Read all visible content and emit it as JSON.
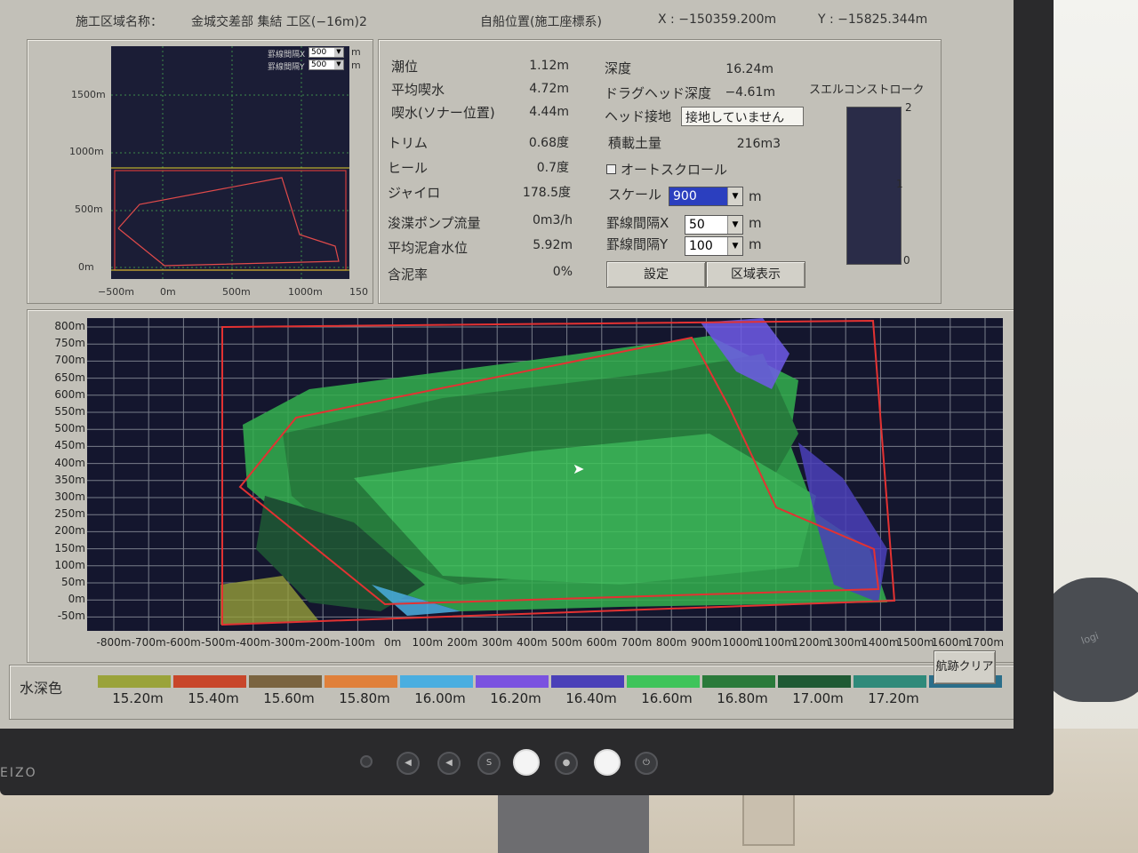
{
  "header": {
    "area_label": "施工区域名称：",
    "area_name": "金城交差部 集結 工区(−16m)2",
    "position_title": "自船位置(施工座標系)",
    "x_pos": "X : −150359.200m",
    "y_pos": "Y : −15825.344m"
  },
  "mini_chart": {
    "grid_x_label": "罫線間隔X",
    "grid_x_value": "500",
    "grid_y_label": "罫線間隔Y",
    "grid_y_value": "500",
    "unit": "m",
    "y_ticks": [
      "1500m",
      "1000m",
      "500m",
      "0m"
    ],
    "x_ticks": [
      "−500m",
      "0m",
      "500m",
      "1000m",
      "150"
    ]
  },
  "status": {
    "tide_label": "潮位",
    "tide_value": "1.12m",
    "avg_draft_label": "平均喫水",
    "avg_draft_value": "4.72m",
    "sonar_draft_label": "喫水(ソナー位置)",
    "sonar_draft_value": "4.44m",
    "trim_label": "トリム",
    "trim_value": "0.68度",
    "heel_label": "ヒール",
    "heel_value": "0.7度",
    "gyro_label": "ジャイロ",
    "gyro_value": "178.5度",
    "pump_label": "浚渫ポンプ流量",
    "pump_value": "0m3/h",
    "hold_label": "平均泥倉水位",
    "hold_value": "5.92m",
    "mud_label": "含泥率",
    "mud_value": "0%",
    "depth_label": "深度",
    "depth_value": "16.24m",
    "draghead_label": "ドラグヘッド深度",
    "draghead_value": "−4.61m",
    "contact_label": "ヘッド接地",
    "contact_value": "接地していません",
    "load_label": "積載土量",
    "load_value": "216m3",
    "autoscroll_label": "オートスクロール",
    "scale_label": "スケール",
    "scale_value": "900",
    "scale_unit": "m",
    "gridx_label": "罫線間隔X",
    "gridx_value": "50",
    "gridx_unit": "m",
    "gridy_label": "罫線間隔Y",
    "gridy_value": "100",
    "gridy_unit": "m",
    "set_button": "設定",
    "area_button": "区域表示",
    "swell_label": "スエルコンストローク",
    "swell_ticks": [
      "2",
      "1",
      "0"
    ]
  },
  "main_chart": {
    "y_ticks": [
      "800m",
      "750m",
      "700m",
      "650m",
      "600m",
      "550m",
      "500m",
      "450m",
      "400m",
      "350m",
      "300m",
      "250m",
      "200m",
      "150m",
      "100m",
      "50m",
      "0m",
      "-50m"
    ],
    "x_ticks": [
      "-800m",
      "-700m",
      "-600m",
      "-500m",
      "-400m",
      "-300m",
      "-200m",
      "-100m",
      "0m",
      "100m",
      "200m",
      "300m",
      "400m",
      "500m",
      "600m",
      "700m",
      "800m",
      "900m",
      "1000m",
      "1100m",
      "1200m",
      "1300m",
      "1400m",
      "1500m",
      "1600m",
      "1700m"
    ]
  },
  "legend": {
    "title": "水深色",
    "items": [
      {
        "label": "15.20m",
        "color": "#9aa33a"
      },
      {
        "label": "15.40m",
        "color": "#c8462a"
      },
      {
        "label": "15.60m",
        "color": "#7a6440"
      },
      {
        "label": "15.80m",
        "color": "#e0803a"
      },
      {
        "label": "16.00m",
        "color": "#4aaee0"
      },
      {
        "label": "16.20m",
        "color": "#7a52e0"
      },
      {
        "label": "16.40m",
        "color": "#4a40b8"
      },
      {
        "label": "16.60m",
        "color": "#3ec45a"
      },
      {
        "label": "16.80m",
        "color": "#2a7a3a"
      },
      {
        "label": "17.00m",
        "color": "#1f5a34"
      },
      {
        "label": "17.20m",
        "color": "#2f8a7a"
      },
      {
        "label": "",
        "color": "#2a6e8a"
      }
    ],
    "clear_button": "航跡クリア"
  },
  "monitor": {
    "brand": "EIZO",
    "mouse_brand": "logi"
  }
}
